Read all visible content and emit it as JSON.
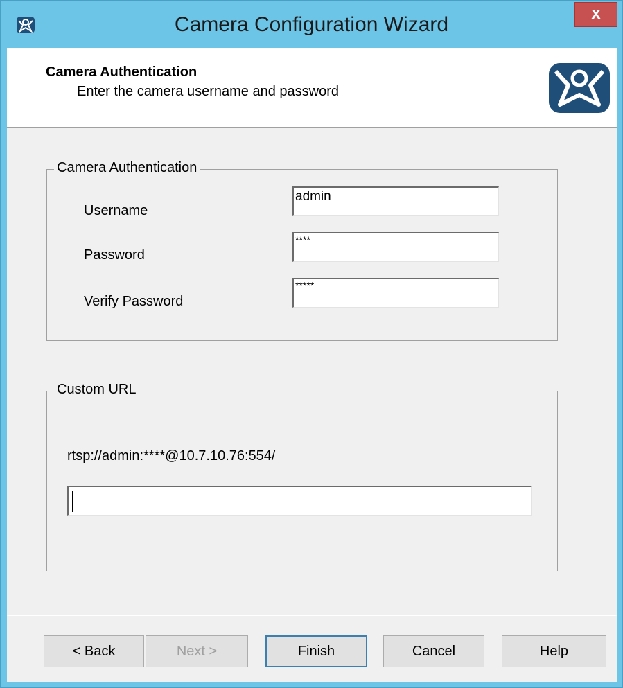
{
  "window": {
    "title": "Camera Configuration Wizard",
    "close_label": "x",
    "accent_color": "#6cc4e6",
    "close_color": "#c75050"
  },
  "header": {
    "title": "Camera Authentication",
    "subtitle": "Enter the camera username and password",
    "logo_icon": "thinmanager-logo-icon"
  },
  "auth_group": {
    "label": "Camera Authentication",
    "username_label": "Username",
    "username_value": "admin",
    "password_label": "Password",
    "password_value": "****",
    "verify_label": "Verify Password",
    "verify_value": "*****"
  },
  "url_group": {
    "label": "Custom URL",
    "url_display": "rtsp://admin:****@10.7.10.76:554/",
    "url_input_value": ""
  },
  "buttons": {
    "back": "< Back",
    "next": "Next >",
    "finish": "Finish",
    "cancel": "Cancel",
    "help": "Help"
  }
}
